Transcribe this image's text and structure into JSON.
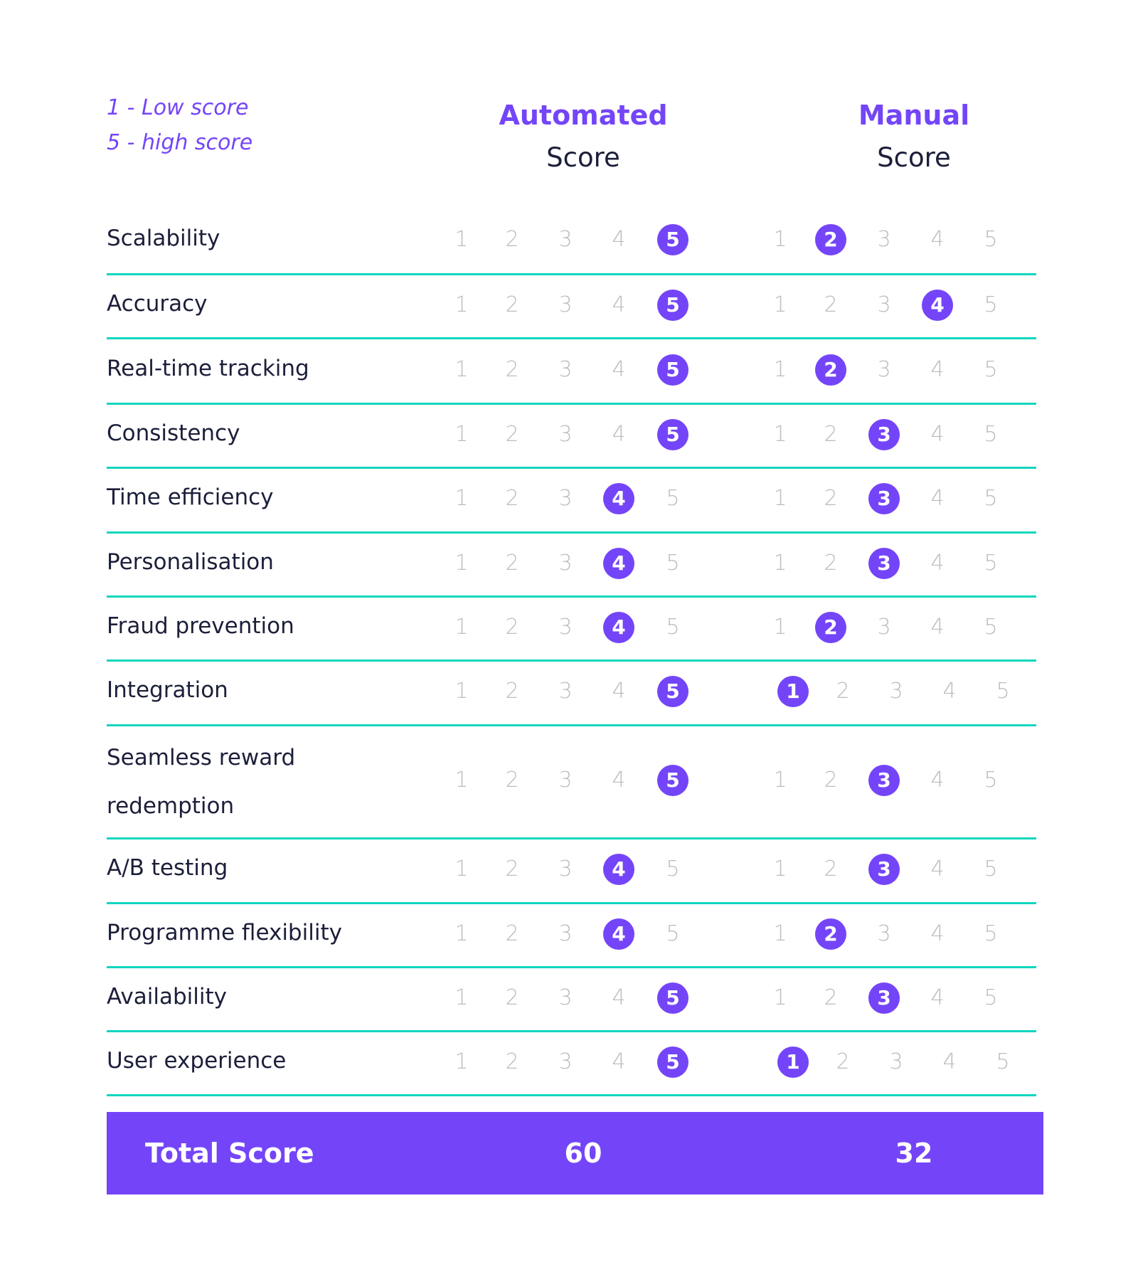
{
  "legend": {
    "low": "1 - Low score",
    "high": "5 - high score"
  },
  "columns": {
    "automated": {
      "title": "Automated",
      "subtitle": "Score"
    },
    "manual": {
      "title": "Manual",
      "subtitle": "Score"
    }
  },
  "scale": [
    1,
    2,
    3,
    4,
    5
  ],
  "colors": {
    "accent": "#7445f8",
    "divider": "#13d6c0",
    "text": "#1c1f3a",
    "muted": "#bcbcbc"
  },
  "rows": [
    {
      "label": "Scalability",
      "automated": 5,
      "manual": 2
    },
    {
      "label": "Accuracy",
      "automated": 5,
      "manual": 4
    },
    {
      "label": "Real-time tracking",
      "automated": 5,
      "manual": 2
    },
    {
      "label": "Consistency",
      "automated": 5,
      "manual": 3
    },
    {
      "label": "Time efficiency",
      "automated": 4,
      "manual": 3
    },
    {
      "label": "Personalisation",
      "automated": 4,
      "manual": 3
    },
    {
      "label": "Fraud prevention",
      "automated": 4,
      "manual": 2
    },
    {
      "label": "Integration",
      "automated": 5,
      "manual": 1
    },
    {
      "label": "Seamless reward redemption",
      "label_lines": [
        "Seamless reward",
        "redemption"
      ],
      "automated": 5,
      "manual": 3
    },
    {
      "label": "A/B testing",
      "automated": 4,
      "manual": 3
    },
    {
      "label": "Programme flexibility",
      "automated": 4,
      "manual": 2
    },
    {
      "label": "Availability",
      "automated": 5,
      "manual": 3
    },
    {
      "label": "User experience",
      "automated": 5,
      "manual": 1
    }
  ],
  "total": {
    "label": "Total Score",
    "automated": "60",
    "manual": "32"
  }
}
